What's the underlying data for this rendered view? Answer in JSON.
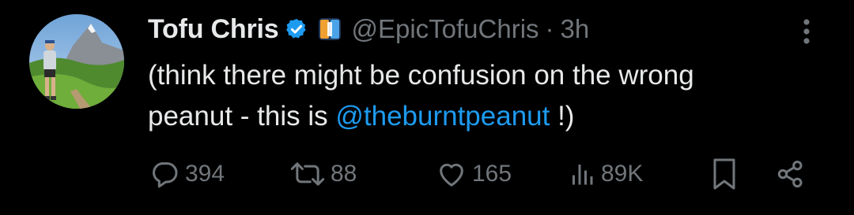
{
  "tweet": {
    "display_name": "Tofu Chris",
    "handle": "@EpicTofuChris",
    "separator": "·",
    "time": "3h",
    "text_line1": "(think there might be confusion on the wrong",
    "text_line2_pre": "peanut - this is ",
    "mention": "@theburntpeanut",
    "text_line2_post": " !)",
    "icons": {
      "verified": "verified-badge-icon",
      "affiliate": "affiliate-badge-icon",
      "more": "more-options-icon"
    }
  },
  "actions": {
    "replies": "394",
    "reposts": "88",
    "likes": "165",
    "views": "89K",
    "icons": [
      "reply-icon",
      "repost-icon",
      "like-icon",
      "views-icon",
      "bookmark-icon",
      "share-icon"
    ]
  },
  "colors": {
    "background": "#000000",
    "text": "#e7e9ea",
    "muted": "#71767b",
    "link": "#1d9bf0",
    "verified": "#1d9bf0"
  }
}
